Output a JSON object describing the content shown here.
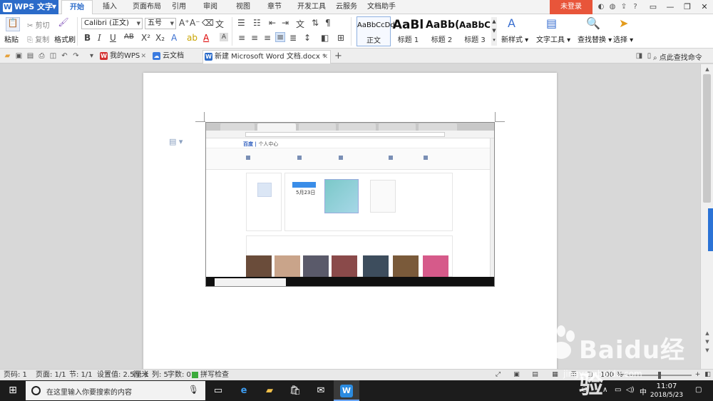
{
  "app": {
    "name": "WPS 文字"
  },
  "ribbon_tabs": [
    "开始",
    "插入",
    "页面布局",
    "引用",
    "审阅",
    "视图",
    "章节",
    "开发工具",
    "云服务",
    "文档助手"
  ],
  "login_label": "未登录",
  "clipboard": {
    "paste": "粘贴",
    "cut": "剪切",
    "copy": "复制",
    "format_painter": "格式刷"
  },
  "font": {
    "name": "Calibri (正文)",
    "size": "五号"
  },
  "styles": [
    {
      "sample": "AaBbCcDd",
      "label": "正文"
    },
    {
      "sample": "AaBl",
      "label": "标题 1"
    },
    {
      "sample": "AaBb(",
      "label": "标题 2"
    },
    {
      "sample": "AaBbC",
      "label": "标题 3"
    }
  ],
  "ribbon_actions": {
    "new_style": "新样式",
    "text_tools": "文字工具",
    "find_replace": "查找替换",
    "select": "选择"
  },
  "doc_tabs": [
    {
      "label": "我的WPS"
    },
    {
      "label": "云文档"
    },
    {
      "label": "新建 Microsoft Word 文档.docx *"
    }
  ],
  "command_search": "点此查找命令",
  "embedded": {
    "site": "百度",
    "section": "个人中心",
    "date": "5月23日"
  },
  "status": {
    "page_num": "页码: 1",
    "pages": "页面: 1/1",
    "section": "节: 1/1",
    "setting": "设置值: 2.5厘米",
    "row": "行: 1",
    "col": "列: 5",
    "words": "字数: 0",
    "spell": "拼写检查",
    "zoom": "100 %",
    "zoom_fraction": 0.5
  },
  "taskbar": {
    "search_placeholder": "在这里输入你要搜索的内容",
    "ime": "中",
    "time": "11:07",
    "date": "2018/5/23"
  },
  "watermark": {
    "text": "Baidu经验",
    "url": "jingyan.baidu.com"
  },
  "colors": {
    "accent": "#2b6bc9",
    "login": "#e8553a",
    "taskbar": "#1c1c1c"
  }
}
